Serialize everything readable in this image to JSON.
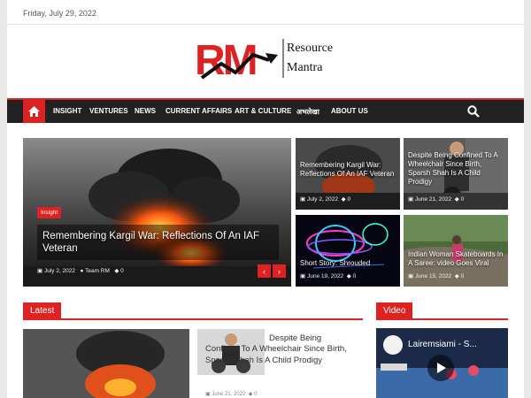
{
  "topbar": {
    "date": "Friday, July 29, 2022"
  },
  "logo": {
    "mark": "RM",
    "line1": "Resource",
    "line2": "Mantra"
  },
  "nav": {
    "items": [
      "INSIGHT",
      "VENTURES",
      "NEWS",
      "CURRENT AFFAIRS",
      "ART & CULTURE",
      "अभलेखा",
      "ABOUT US"
    ]
  },
  "slider": {
    "badge": "Insight",
    "title": "Remembering Kargil War: Reflections Of An IAF Veteran",
    "date": "July 2, 2022",
    "author": "Team RM",
    "comments": "0"
  },
  "grid": [
    {
      "title": "Remembering Kargil War: Reflections Of An IAF Veteran",
      "date": "July 2, 2022",
      "comments": "0"
    },
    {
      "title": "Despite Being Confined To A Wheelchair Since Birth, Sparsh Shah Is A Child Prodigy",
      "date": "June 21, 2022",
      "comments": "0"
    },
    {
      "title": "Short Story: Shrouded",
      "date": "June 19, 2022",
      "comments": "0"
    },
    {
      "title": "Indian Woman Skateboards In A Saree: video Goes Viral",
      "date": "June 15, 2022",
      "comments": "0"
    }
  ],
  "latest": {
    "heading": "Latest",
    "item": {
      "title": "Despite Being Confined To A Wheelchair Since Birth, Sparsh Shah Is A Child Prodigy",
      "date": "June 21, 2022",
      "comments": "0"
    }
  },
  "video": {
    "heading": "Video",
    "title": "Lairemsiami - S..."
  },
  "colors": {
    "accent": "#dd2222",
    "nav_bg": "#212121"
  }
}
